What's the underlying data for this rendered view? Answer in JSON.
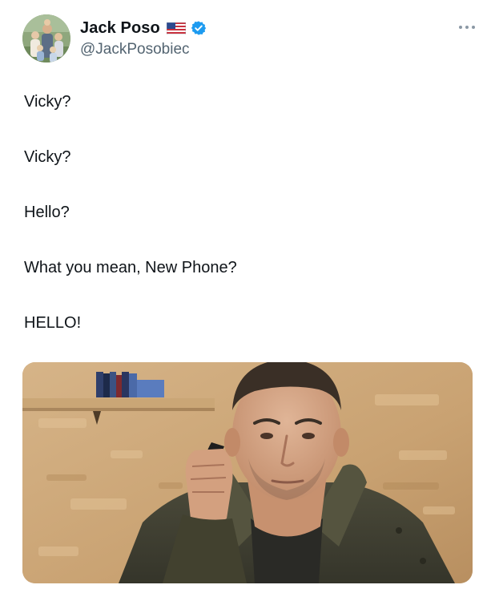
{
  "author": {
    "display_name": "Jack Poso",
    "handle": "@JackPosobiec",
    "avatar": "profile-photo",
    "flag": "us-flag-emoji",
    "verified": true,
    "verified_color": "#1d9bf0"
  },
  "menu": {
    "icon": "more-options-icon"
  },
  "tweet": {
    "lines": [
      "Vicky?",
      "Vicky?",
      "Hello?",
      "What you mean, New Phone?",
      "HELLO!"
    ]
  },
  "media": {
    "description": "photo-attachment",
    "type": "image"
  }
}
